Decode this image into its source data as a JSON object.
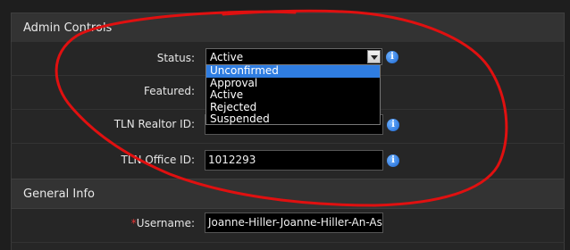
{
  "admin": {
    "title": "Admin Controls",
    "status": {
      "label": "Status:",
      "value": "Active",
      "options": [
        "Unconfirmed",
        "Approval",
        "Active",
        "Rejected",
        "Suspended"
      ],
      "highlighted": "Unconfirmed"
    },
    "featured": {
      "label": "Featured:"
    },
    "tln_realtor": {
      "label": "TLN Realtor ID:",
      "value": ""
    },
    "tln_office": {
      "label": "TLN Office ID:",
      "value": "1012293"
    }
  },
  "general": {
    "title": "General Info",
    "username": {
      "required_marker": "*",
      "label": "Username:",
      "value": "Joanne-Hiller-Joanne-Hiller-An-Ass"
    }
  },
  "icons": {
    "info": "info-icon"
  },
  "colors": {
    "annotation": "#e01010",
    "highlight": "#2f7de1"
  }
}
